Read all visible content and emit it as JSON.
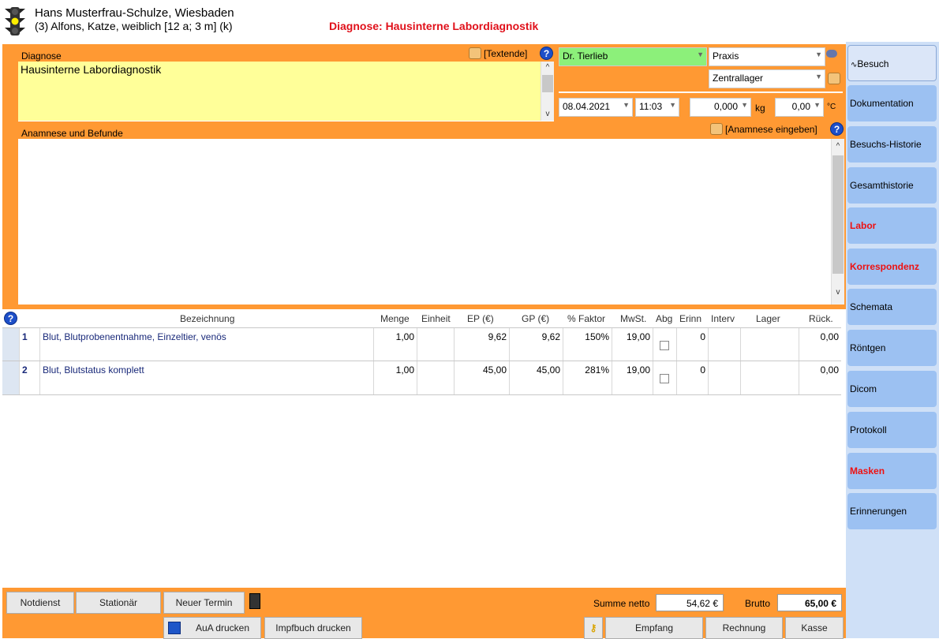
{
  "header": {
    "owner": "Hans Musterfrau-Schulze, Wiesbaden",
    "patient": "(3) Alfons, Katze, weiblich [12 a; 3 m] (k)",
    "diagnosis_title": "Diagnose: Hausinterne Labordiagnostik"
  },
  "diagnose": {
    "label": "Diagnose",
    "text": "Hausinterne Labordiagnostik",
    "textende": "[Textende]"
  },
  "vet": {
    "doctor": "Dr. Tierlieb",
    "location": "Praxis",
    "storage": "Zentrallager"
  },
  "visit": {
    "date": "08.04.2021",
    "time": "11:03",
    "weight": "0,000",
    "weight_unit": "kg",
    "temp": "0,00",
    "temp_unit": "°C"
  },
  "anamnese": {
    "label": "Anamnese und Befunde",
    "enter": "[Anamnese eingeben]"
  },
  "table": {
    "headers": [
      "Bezeichnung",
      "Menge",
      "Einheit",
      "EP (€)",
      "GP (€)",
      "% Faktor",
      "MwSt.",
      "Abg",
      "Erinn",
      "Interv",
      "Lager",
      "Rück."
    ],
    "rows": [
      {
        "nr": "1",
        "name": "Blut, Blutprobenentnahme, Einzeltier, venös",
        "menge": "1,00",
        "ep": "9,62",
        "gp": "9,62",
        "faktor": "150%",
        "mwst": "19,00",
        "erinn": "0",
        "rueck": "0,00"
      },
      {
        "nr": "2",
        "name": "Blut, Blutstatus komplett",
        "menge": "1,00",
        "ep": "45,00",
        "gp": "45,00",
        "faktor": "281%",
        "mwst": "19,00",
        "erinn": "0",
        "rueck": "0,00"
      }
    ]
  },
  "sidebar": {
    "items": [
      {
        "label": "Besuch",
        "selected": true
      },
      {
        "label": "Dokumentation"
      },
      {
        "label": "Besuchs-Historie"
      },
      {
        "label": "Gesamthistorie"
      },
      {
        "label": "Labor",
        "red": true
      },
      {
        "label": "Korrespondenz",
        "red": true
      },
      {
        "label": "Schemata"
      },
      {
        "label": "Röntgen"
      },
      {
        "label": "Dicom"
      },
      {
        "label": "Protokoll"
      },
      {
        "label": "Masken",
        "red": true
      },
      {
        "label": "Erinnerungen"
      }
    ]
  },
  "footer": {
    "notdienst": "Notdienst",
    "stationaer": "Stationär",
    "neuer_termin": "Neuer Termin",
    "summe_label": "Summe netto",
    "summe": "54,62 €",
    "brutto_label": "Brutto",
    "brutto": "65,00 €",
    "aua": "AuA drucken",
    "impfbuch": "Impfbuch drucken",
    "empfang": "Empfang",
    "rechnung": "Rechnung",
    "kasse": "Kasse"
  },
  "colors": {
    "orange": "#ff9933",
    "yellow": "#ffff99",
    "red": "#e0101a",
    "tab": "#9cc1f2",
    "green": "#8cf07a"
  }
}
